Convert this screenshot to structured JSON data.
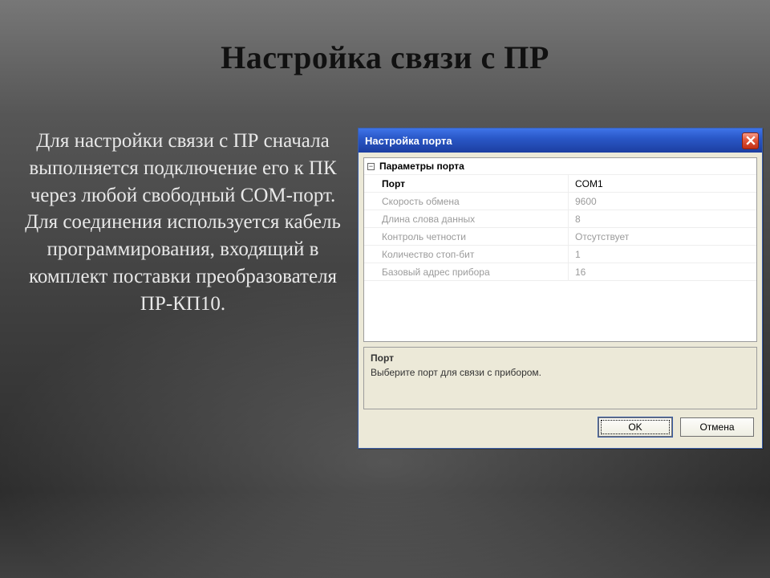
{
  "slide": {
    "title": "Настройка связи с ПР",
    "body": "Для настройки связи с ПР сначала выполняется подключение его к ПК через любой свободный COM-порт. Для соединения используется кабель программирования, входящий в комплект поставки преобразователя ПР-КП10."
  },
  "dialog": {
    "title": "Настройка порта",
    "group_label": "Параметры порта",
    "params": [
      {
        "name": "Порт",
        "value": "COM1",
        "active": true
      },
      {
        "name": "Скорость обмена",
        "value": "9600",
        "active": false
      },
      {
        "name": "Длина слова данных",
        "value": "8",
        "active": false
      },
      {
        "name": "Контроль четности",
        "value": "Отсутствует",
        "active": false
      },
      {
        "name": "Количество стоп-бит",
        "value": "1",
        "active": false
      },
      {
        "name": "Базовый адрес прибора",
        "value": "16",
        "active": false
      }
    ],
    "help": {
      "title": "Порт",
      "text": "Выберите порт для связи с прибором."
    },
    "buttons": {
      "ok": "OK",
      "cancel": "Отмена"
    }
  }
}
